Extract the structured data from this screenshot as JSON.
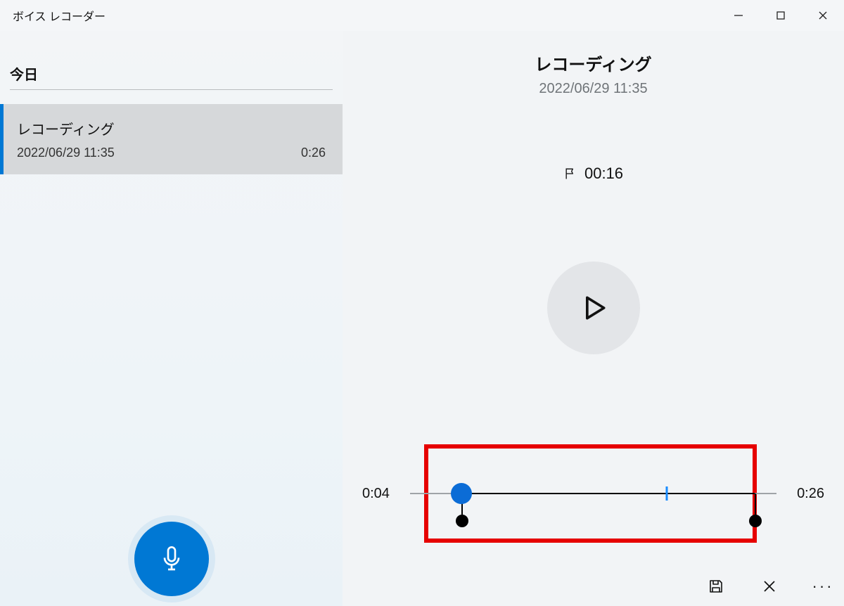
{
  "app": {
    "title": "ボイス レコーダー"
  },
  "sidebar": {
    "section_label": "今日",
    "items": [
      {
        "title": "レコーディング",
        "datetime": "2022/06/29 11:35",
        "duration": "0:26"
      }
    ]
  },
  "detail": {
    "title": "レコーディング",
    "datetime": "2022/06/29 11:35",
    "marker_time": "00:16",
    "timeline": {
      "start_label": "0:04",
      "end_label": "0:26",
      "playhead_pct": 14,
      "trim_start_pct": 14,
      "trim_end_pct": 94,
      "tick_pct": 70
    }
  }
}
